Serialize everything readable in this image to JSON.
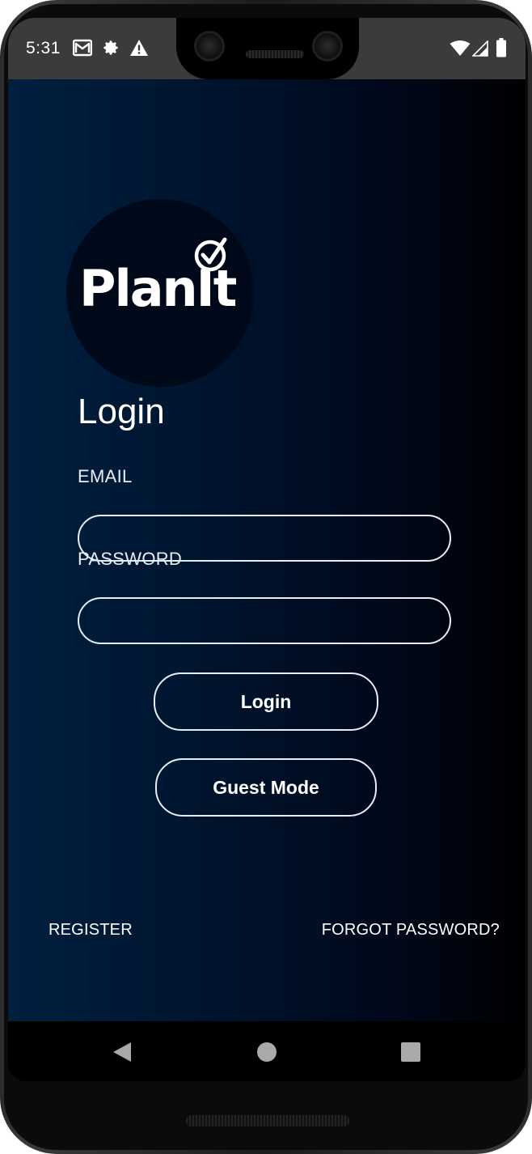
{
  "status_bar": {
    "time": "5:31",
    "left_icons": [
      "gmail-icon",
      "settings-gear-icon",
      "alert-triangle-icon"
    ],
    "right_icons": [
      "wifi-icon",
      "cellular-signal-icon",
      "battery-icon"
    ]
  },
  "app": {
    "logo_text": "PlanIt",
    "title": "Login",
    "email_label": "EMAIL",
    "email_value": "",
    "password_label": "PASSWORD",
    "password_value": "",
    "login_button": "Login",
    "guest_button": "Guest Mode",
    "register_link": "REGISTER",
    "forgot_link": "FORGOT PASSWORD?"
  },
  "nav_bar": {
    "icons": [
      "back-triangle-icon",
      "home-circle-icon",
      "recents-square-icon"
    ]
  },
  "colors": {
    "background_start": "#00203f",
    "background_end": "#000000",
    "outline": "#e8eef5",
    "text": "#ffffff"
  }
}
